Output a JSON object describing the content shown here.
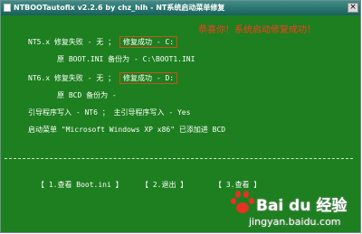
{
  "window": {
    "title": "NTBOOTautofix v2.2.6 by chz_hlh - NT系统启动菜单修复",
    "close_label": "×"
  },
  "banner": {
    "text": "恭喜你！系统启动修复成功！"
  },
  "nt5": {
    "prefix": "NT5.x 修复失败 - 无 ；",
    "result": "修复成功 - C:",
    "backup": "原 BOOT.INI 备份为 - C:\\BOOT1.INI"
  },
  "nt6": {
    "prefix": "NT6.x 修复失败 - 无 ；",
    "result": "修复成功 - D:",
    "backup": "原 BCD 备份为 -"
  },
  "loader": {
    "text": "引导程序写入 - NT6   ；   主引导程序写入 - Yes"
  },
  "menu_added": {
    "text": "启动菜单 \"Microsoft Windows XP x86\" 已添加进 BCD"
  },
  "actions": [
    {
      "label": "【 1.查看 Boot.ini 】"
    },
    {
      "label": "【 2.退出 】"
    },
    {
      "label": "【 3.查看 】"
    }
  ],
  "watermark": {
    "text": "Bai du 经验",
    "url": "jingyan.baidu.com"
  },
  "colors": {
    "background": "#1d7f1f",
    "titlebar": "#19605b",
    "banner": "#ff3b1f",
    "box_border": "#c8541b"
  }
}
